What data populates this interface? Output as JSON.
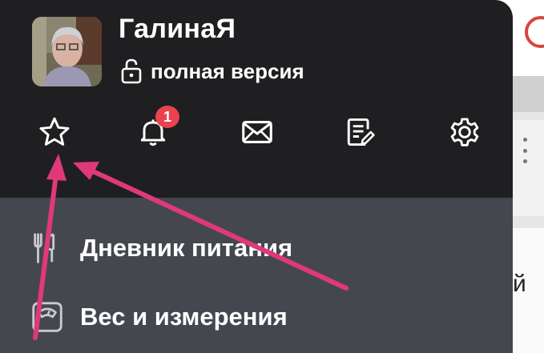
{
  "profile": {
    "username": "ГалинаЯ",
    "version_label": "полная версия",
    "avatar": "avatar-photo"
  },
  "iconbar": [
    {
      "icon": "star-icon"
    },
    {
      "icon": "bell-icon",
      "badge": "1"
    },
    {
      "icon": "mail-icon"
    },
    {
      "icon": "notes-icon"
    },
    {
      "icon": "gear-icon"
    }
  ],
  "menu": {
    "items": [
      {
        "label": "Дневник питания",
        "icon": "fork-knife-icon"
      },
      {
        "label": "Вес и измерения",
        "icon": "scale-icon"
      }
    ]
  },
  "background": {
    "partial_letter": "й"
  },
  "colors": {
    "header_bg": "#1f1f21",
    "menu_bg": "#45474f",
    "badge": "#e8434e",
    "annotation_arrow": "#e0397a",
    "bg_logo": "#d9443a"
  }
}
